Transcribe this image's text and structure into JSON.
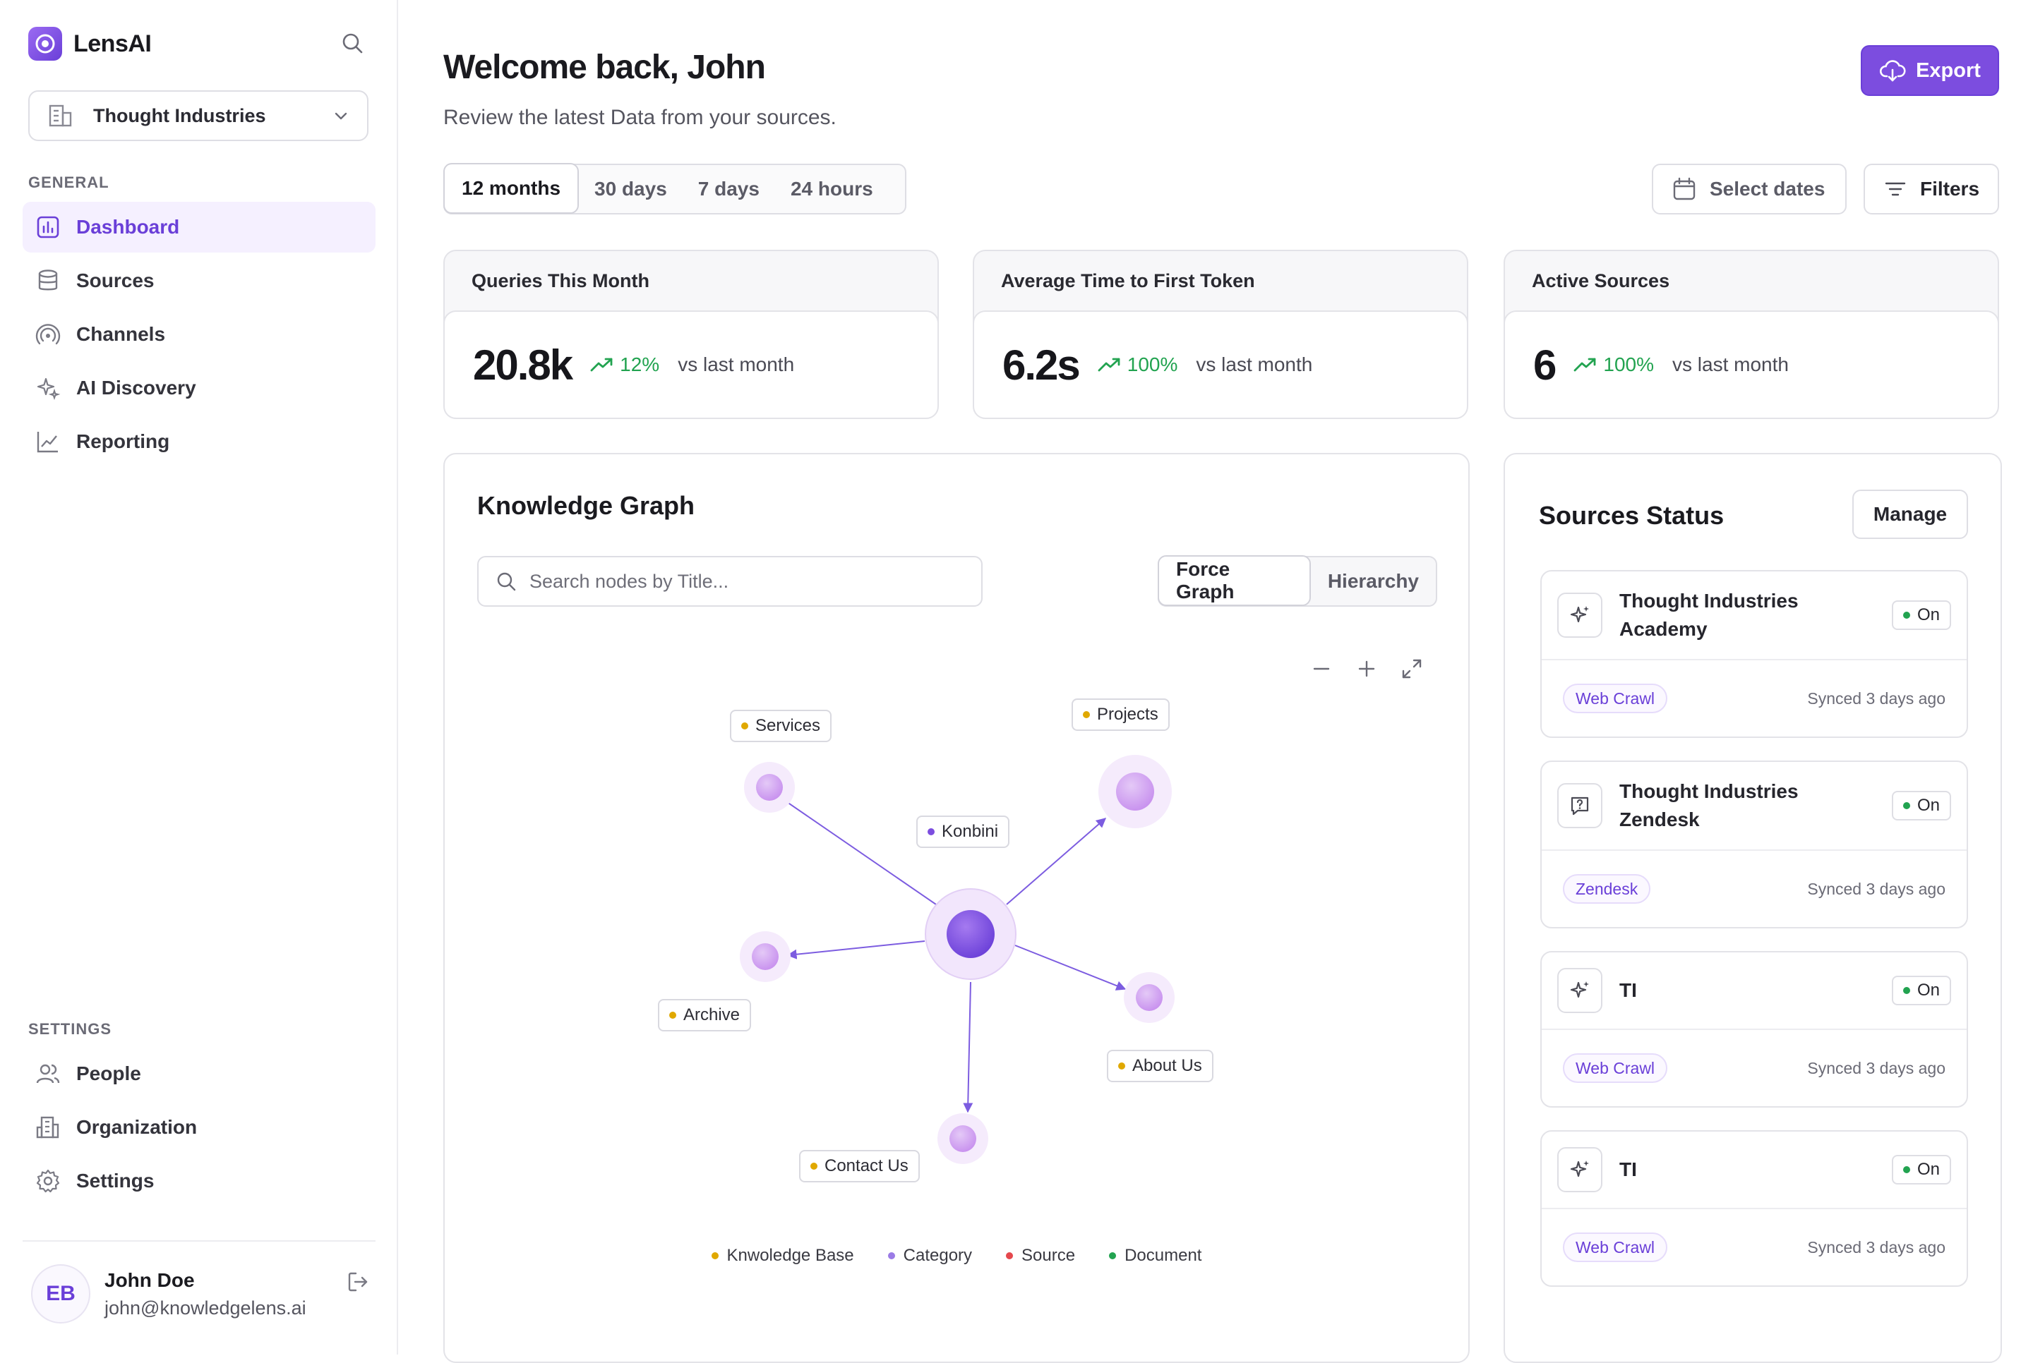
{
  "app": {
    "name": "LensAI"
  },
  "org": {
    "selected": "Thought Industries"
  },
  "sidebar": {
    "general_label": "GENERAL",
    "settings_label": "SETTINGS",
    "general_items": [
      {
        "label": "Dashboard",
        "icon": "bar-chart-icon",
        "active": true
      },
      {
        "label": "Sources",
        "icon": "database-icon"
      },
      {
        "label": "Channels",
        "icon": "broadcast-icon"
      },
      {
        "label": "AI Discovery",
        "icon": "sparkles-icon"
      },
      {
        "label": "Reporting",
        "icon": "line-chart-icon"
      }
    ],
    "settings_items": [
      {
        "label": "People",
        "icon": "users-icon"
      },
      {
        "label": "Organization",
        "icon": "building-icon"
      },
      {
        "label": "Settings",
        "icon": "gear-icon"
      }
    ]
  },
  "user": {
    "initials": "EB",
    "name": "John Doe",
    "email": "john@knowledgelens.ai"
  },
  "header": {
    "title": "Welcome back, John",
    "subtitle": "Review the latest Data from your sources.",
    "export_label": "Export",
    "select_dates_label": "Select dates",
    "filters_label": "Filters"
  },
  "time_ranges": [
    "12 months",
    "30 days",
    "7 days",
    "24 hours"
  ],
  "stats": [
    {
      "title": "Queries This Month",
      "value": "20.8k",
      "change": "12%",
      "note": "vs last month"
    },
    {
      "title": "Average Time to First Token",
      "value": "6.2s",
      "change": "100%",
      "note": "vs last month"
    },
    {
      "title": "Active Sources",
      "value": "6",
      "change": "100%",
      "note": "vs last month"
    }
  ],
  "graph": {
    "title": "Knowledge Graph",
    "search_placeholder": "Search nodes by Title...",
    "views": [
      "Force Graph",
      "Hierarchy"
    ],
    "center_node": "Konbini",
    "nodes": [
      "Services",
      "Projects",
      "Archive",
      "About Us",
      "Contact Us"
    ],
    "legend": [
      {
        "label": "Knwoledge Base",
        "color": "#e0a800"
      },
      {
        "label": "Category",
        "color": "#9b7be6"
      },
      {
        "label": "Source",
        "color": "#e5484d"
      },
      {
        "label": "Document",
        "color": "#22a350"
      }
    ]
  },
  "sources_status": {
    "title": "Sources Status",
    "manage_label": "Manage",
    "items": [
      {
        "name": "Thought Industries Academy",
        "status": "On",
        "type": "Web Crawl",
        "synced": "Synced 3 days ago",
        "icon": "sparkles-icon"
      },
      {
        "name": "Thought Industries Zendesk",
        "status": "On",
        "type": "Zendesk",
        "synced": "Synced 3 days ago",
        "icon": "chat-question-icon"
      },
      {
        "name": "TI",
        "status": "On",
        "type": "Web Crawl",
        "synced": "Synced 3 days ago",
        "icon": "sparkles-icon"
      },
      {
        "name": "TI",
        "status": "On",
        "type": "Web Crawl",
        "synced": "Synced 3 days ago",
        "icon": "sparkles-icon"
      }
    ]
  },
  "colors": {
    "accent": "#7c4ddf",
    "positive": "#22a350",
    "kb_dot": "#e0a800"
  }
}
